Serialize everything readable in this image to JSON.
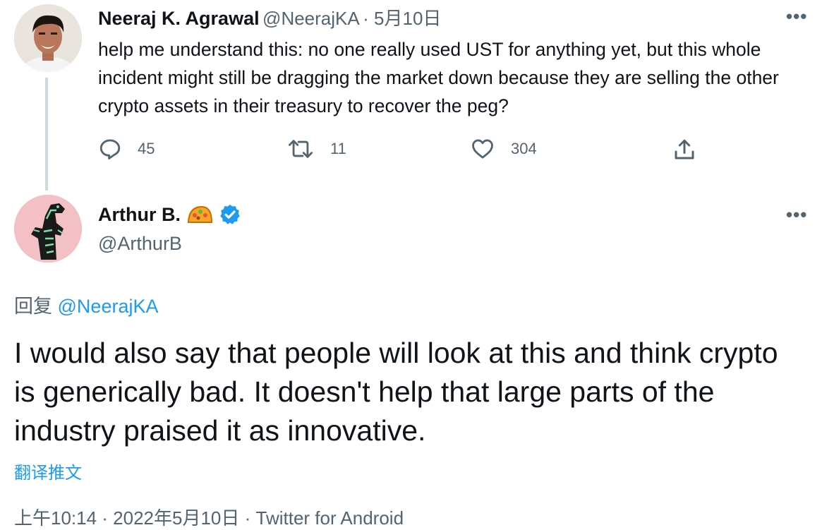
{
  "parent_tweet": {
    "author_name": "Neeraj K. Agrawal",
    "author_handle": "@NeerajKA",
    "date": "· 5月10日",
    "text": "help me understand this: no one really used UST for anything yet, but this whole incident might still be dragging the market down because they are selling the other crypto assets in their treasury to recover the peg?",
    "replies": "45",
    "retweets": "11",
    "likes": "304",
    "more": "•••"
  },
  "main_tweet": {
    "author_name": "Arthur B.",
    "author_handle": "@ArthurB",
    "more": "•••",
    "reply_prefix": "回复",
    "reply_handle": "@NeerajKA",
    "text": "I would also say that people will look at this and think crypto is generically bad. It doesn't help that large parts of the industry praised it as innovative.",
    "translate_label": "翻译推文",
    "meta": "上午10:14 · 2022年5月10日 · Twitter for Android"
  },
  "colors": {
    "link": "#1d9bf0",
    "verified": "#1d9bf0",
    "muted": "#536471"
  },
  "icons": [
    "reply-icon",
    "retweet-icon",
    "like-icon",
    "share-icon",
    "verified-badge-icon",
    "taco-emoji-icon"
  ]
}
